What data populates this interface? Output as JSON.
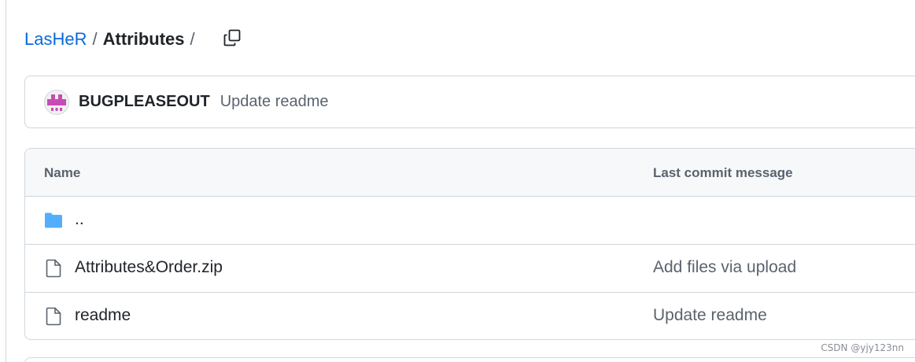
{
  "breadcrumb": {
    "repo": "LasHeR",
    "separator": "/",
    "current": "Attributes",
    "trailing_separator": "/"
  },
  "commit": {
    "author": "BUGPLEASEOUT",
    "message": "Update readme"
  },
  "table": {
    "headers": {
      "name": "Name",
      "last_commit": "Last commit message"
    },
    "rows": [
      {
        "icon": "folder-icon",
        "name": "..",
        "commit": ""
      },
      {
        "icon": "file-icon",
        "name": "Attributes&Order.zip",
        "commit": "Add files via upload"
      },
      {
        "icon": "file-icon",
        "name": "readme",
        "commit": "Update readme"
      }
    ]
  },
  "watermark": "CSDN @yjy123nn",
  "colors": {
    "link": "#0969da",
    "folder": "#54aeff",
    "muted": "#59636e",
    "border": "#d0d7de",
    "avatar": "#c64cb4"
  }
}
